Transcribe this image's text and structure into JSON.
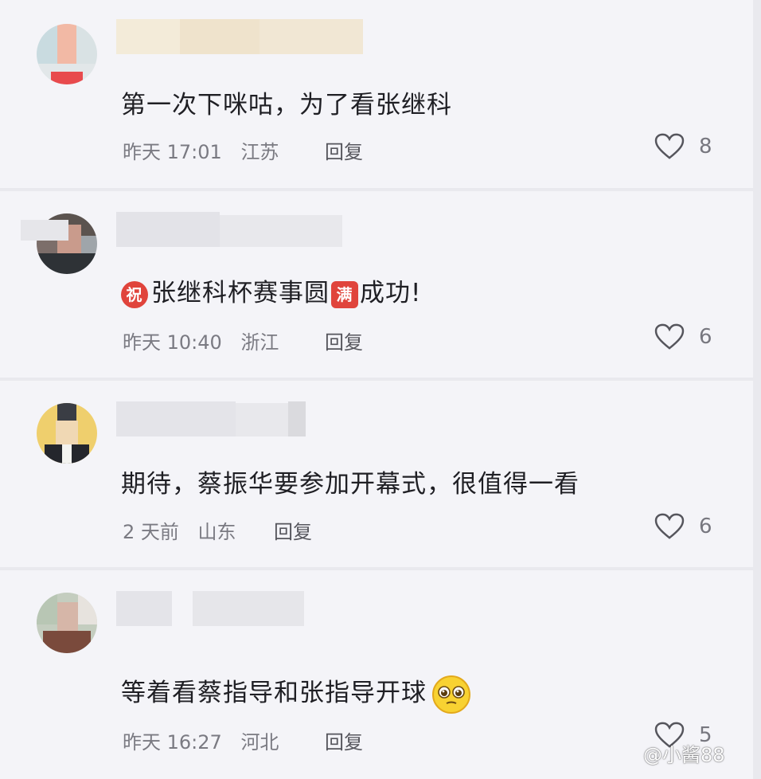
{
  "comments": [
    {
      "text": "第一次下咪咕，为了看张继科",
      "time": "昨天 17:01",
      "location": "江苏",
      "reply_label": "回复",
      "likes": "8",
      "avatar_colors": [
        "#c9dbe0",
        "#f2b9a5",
        "#d9e2e4",
        "#e2e7e9",
        "#f0a3a0",
        "#e84a4d"
      ]
    },
    {
      "badge_left": "祝",
      "text_before": "张继科杯赛事圆",
      "badge_mid": "满",
      "text_after": "成功!",
      "time": "昨天 10:40",
      "location": "浙江",
      "reply_label": "回复",
      "likes": "6",
      "avatar_colors": [
        "#5b534f",
        "#c99b8c",
        "#7c6e6a",
        "#9fa5aa",
        "#2e3236",
        "#54606a"
      ]
    },
    {
      "text": "期待，蔡振华要参加开幕式，很值得一看",
      "time": "2 天前",
      "location": "山东",
      "reply_label": "回复",
      "likes": "6",
      "avatar_colors": [
        "#e8d47a",
        "#f0d8b4",
        "#efcf6d",
        "#d8c893",
        "#24262c",
        "#f3f3f0"
      ]
    },
    {
      "text": "等着看蔡指导和张指导开球",
      "time": "昨天 16:27",
      "location": "河北",
      "reply_label": "回复",
      "likes": "5",
      "avatar_colors": [
        "#b8c6b4",
        "#d6b6a8",
        "#c4cdbf",
        "#e7e3de",
        "#7a4a3c",
        "#caa291"
      ]
    }
  ],
  "watermark": "@小酱88",
  "colors": {
    "badge_red": "#e0443c",
    "card_bg": "#f4f4f8",
    "divider": "#e9e9ee"
  }
}
